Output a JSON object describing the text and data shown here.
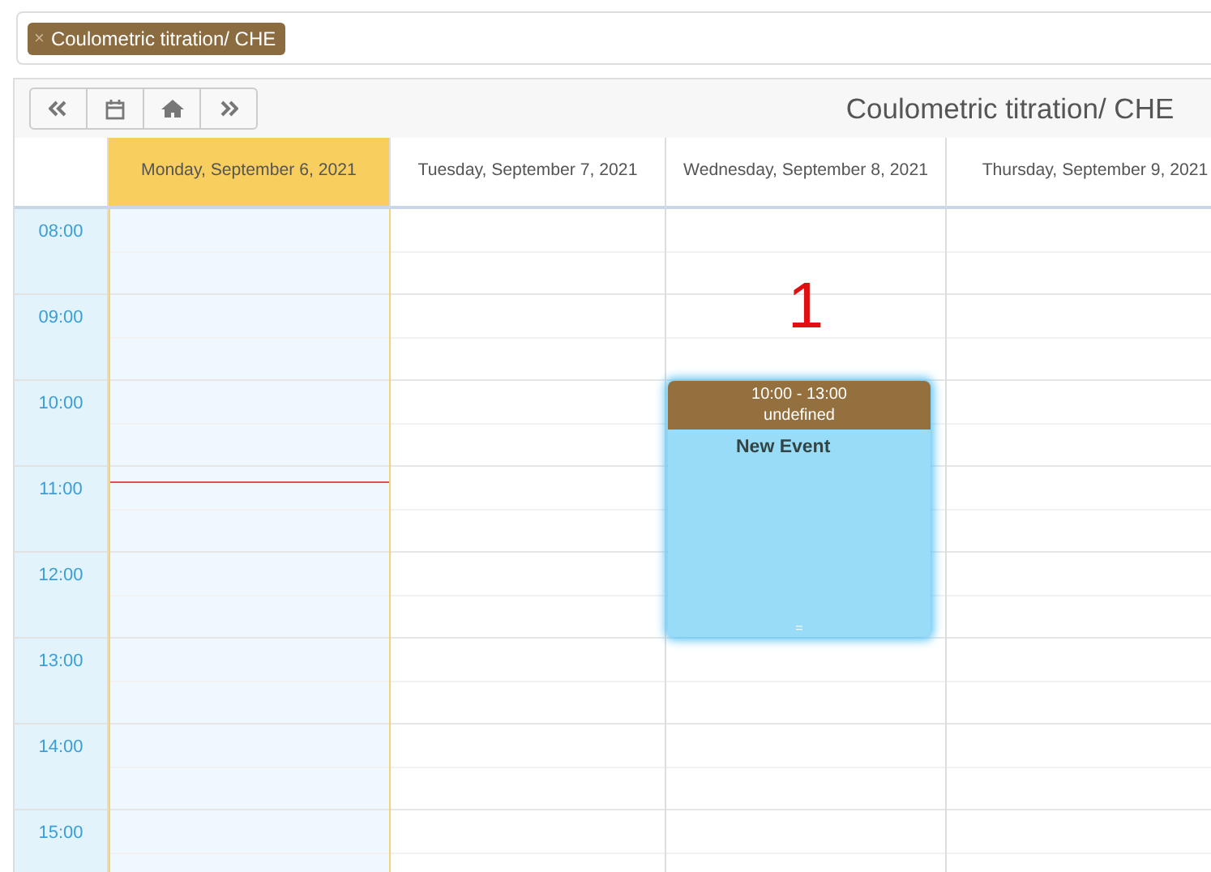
{
  "filter": {
    "tags": [
      {
        "remove": "×",
        "label": "Coulometric titration/ CHE"
      }
    ]
  },
  "calendar": {
    "title": "Coulometric titration/ CHE",
    "hours": [
      "08:00",
      "09:00",
      "10:00",
      "11:00",
      "12:00",
      "13:00",
      "14:00",
      "15:00"
    ],
    "days": [
      {
        "label": "Monday, September 6, 2021",
        "today": true
      },
      {
        "label": "Tuesday, September 7, 2021",
        "today": false
      },
      {
        "label": "Wednesday, September 8, 2021",
        "today": false,
        "marker": "1",
        "events": [
          {
            "time": "10:00 - 13:00",
            "subtitle": "undefined",
            "title": "New Event",
            "handle": "=",
            "selected": true
          }
        ]
      },
      {
        "label": "Thursday, September 9, 2021",
        "today": false
      }
    ]
  }
}
